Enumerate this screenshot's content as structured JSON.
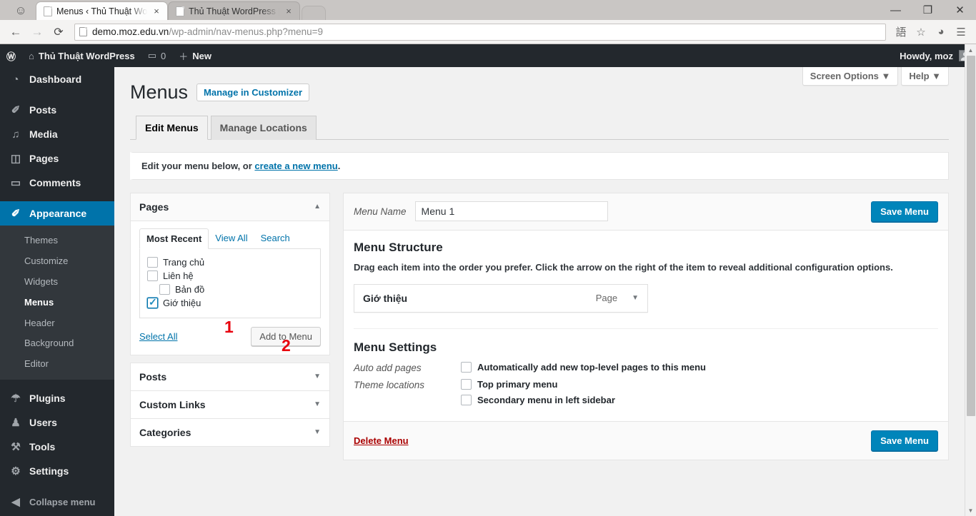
{
  "browser": {
    "tabs": [
      {
        "title": "Menus ‹ Thủ Thuật WordP",
        "close": "×",
        "active": true
      },
      {
        "title": "Thủ Thuật WordPress | Jus",
        "close": "×",
        "active": false
      }
    ],
    "window_controls": {
      "minimize": "—",
      "maximize": "❐",
      "close": "✕"
    },
    "nav": {
      "back": "←",
      "forward": "→",
      "reload": "⟳"
    },
    "url_domain": "demo.moz.edu.vn",
    "url_path": "/wp-admin/nav-menus.php?menu=9",
    "toolbar_icons": {
      "translate": "語",
      "bookmark": "☆",
      "profile": "◕",
      "menu": "☰"
    }
  },
  "adminbar": {
    "logo": "Ⓦ",
    "home_icon": "⌂",
    "site_name": "Thủ Thuật WordPress",
    "comment_icon": "▭",
    "comment_count": "0",
    "new_icon": "＋",
    "new_label": "New",
    "howdy": "Howdy, moz"
  },
  "sidebar": {
    "items": [
      {
        "label": "Dashboard",
        "icon": "◔",
        "icon_name": "dashboard-icon",
        "active": false
      },
      {
        "label": "Posts",
        "icon": "✐",
        "icon_name": "pin-icon",
        "active": false
      },
      {
        "label": "Media",
        "icon": "♫",
        "icon_name": "media-icon",
        "active": false
      },
      {
        "label": "Pages",
        "icon": "◫",
        "icon_name": "page-icon",
        "active": false
      },
      {
        "label": "Comments",
        "icon": "▭",
        "icon_name": "comment-icon",
        "active": false
      },
      {
        "label": "Appearance",
        "icon": "✐",
        "icon_name": "brush-icon",
        "active": true
      }
    ],
    "submenu": [
      {
        "label": "Themes",
        "current": false
      },
      {
        "label": "Customize",
        "current": false
      },
      {
        "label": "Widgets",
        "current": false
      },
      {
        "label": "Menus",
        "current": true
      },
      {
        "label": "Header",
        "current": false
      },
      {
        "label": "Background",
        "current": false
      },
      {
        "label": "Editor",
        "current": false
      }
    ],
    "items_lower": [
      {
        "label": "Plugins",
        "icon": "☂",
        "icon_name": "plugin-icon"
      },
      {
        "label": "Users",
        "icon": "♟",
        "icon_name": "user-icon"
      },
      {
        "label": "Tools",
        "icon": "⚒",
        "icon_name": "wrench-icon"
      },
      {
        "label": "Settings",
        "icon": "⚙",
        "icon_name": "gear-icon"
      }
    ],
    "collapse": {
      "label": "Collapse menu",
      "icon": "◀"
    }
  },
  "screen_meta": {
    "screen_options": "Screen Options ▼",
    "help": "Help ▼"
  },
  "page": {
    "title": "Menus",
    "customizer_button": "Manage in Customizer",
    "tabs": [
      {
        "label": "Edit Menus",
        "active": true
      },
      {
        "label": "Manage Locations",
        "active": false
      }
    ],
    "notice_prefix": "Edit your menu below, or ",
    "notice_link": "create a new menu",
    "notice_suffix": "."
  },
  "pages_box": {
    "title": "Pages",
    "toggle": "▲",
    "tabs": [
      {
        "label": "Most Recent",
        "active": true
      },
      {
        "label": "View All",
        "active": false
      },
      {
        "label": "Search",
        "active": false
      }
    ],
    "items": [
      {
        "label": "Trang chủ",
        "checked": false,
        "indent": false
      },
      {
        "label": "Liên hệ",
        "checked": false,
        "indent": false
      },
      {
        "label": "Bản đồ",
        "checked": false,
        "indent": true
      },
      {
        "label": "Giớ thiệu",
        "checked": true,
        "indent": false
      }
    ],
    "select_all": "Select All",
    "add_to_menu": "Add to Menu"
  },
  "other_boxes": [
    {
      "title": "Posts",
      "toggle": "▼"
    },
    {
      "title": "Custom Links",
      "toggle": "▼"
    },
    {
      "title": "Categories",
      "toggle": "▼"
    }
  ],
  "annotations": [
    {
      "label": "1",
      "color": "#e8000d"
    },
    {
      "label": "2",
      "color": "#e8000d"
    }
  ],
  "menu_panel": {
    "menu_name_label": "Menu Name",
    "menu_name_value": "Menu 1",
    "save_menu_top": "Save Menu",
    "structure_heading": "Menu Structure",
    "structure_help": "Drag each item into the order you prefer. Click the arrow on the right of the item to reveal additional configuration options.",
    "menu_items": [
      {
        "title": "Giớ thiệu",
        "type": "Page",
        "arrow": "▼"
      }
    ],
    "settings_heading": "Menu Settings",
    "auto_add_label": "Auto add pages",
    "auto_add_option": "Automatically add new top-level pages to this menu",
    "auto_add_checked": false,
    "theme_locations_label": "Theme locations",
    "theme_locations": [
      {
        "label": "Top primary menu",
        "checked": false
      },
      {
        "label": "Secondary menu in left sidebar",
        "checked": false
      }
    ],
    "delete_menu": "Delete Menu",
    "save_menu_bottom": "Save Menu"
  },
  "scrollbar": {
    "up": "▲",
    "down": "▼"
  },
  "colors": {
    "wp_blue": "#0073aa",
    "wp_button_blue": "#0085ba",
    "admin_dark": "#23282d",
    "submenu_dark": "#32373c",
    "annotation_red": "#e8000d",
    "delete_red": "#a00"
  }
}
